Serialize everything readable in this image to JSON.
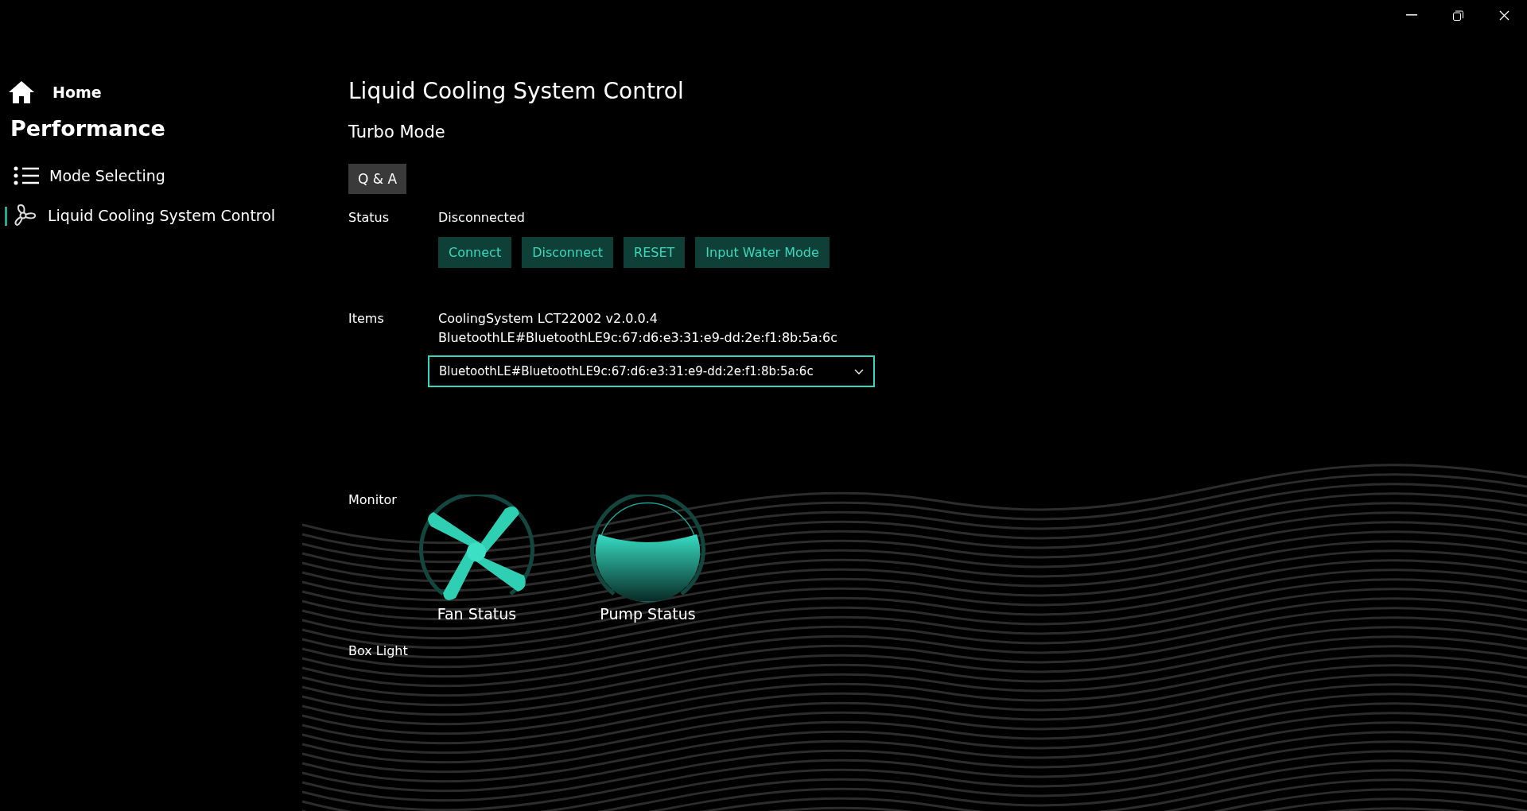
{
  "sidebar": {
    "home": "Home",
    "section": "Performance",
    "items": [
      {
        "label": "Mode Selecting",
        "kind": "list",
        "selected": false
      },
      {
        "label": "Liquid Cooling System Control",
        "kind": "fan",
        "selected": true
      }
    ]
  },
  "page": {
    "title": "Liquid Cooling System Control",
    "subtitle": "Turbo Mode",
    "qa_button": "Q & A",
    "status": {
      "label": "Status",
      "value": "Disconnected",
      "buttons": [
        "Connect",
        "Disconnect",
        "RESET",
        "Input Water Mode"
      ]
    },
    "items": {
      "label": "Items",
      "lines": [
        "CoolingSystem LCT22002 v2.0.0.4",
        "BluetoothLE#BluetoothLE9c:67:d6:e3:31:e9-dd:2e:f1:8b:5a:6c"
      ],
      "dropdown": {
        "value": "BluetoothLE#BluetoothLE9c:67:d6:e3:31:e9-dd:2e:f1:8b:5a:6c"
      }
    },
    "monitor": {
      "label": "Monitor",
      "gauges": [
        {
          "kind": "fan",
          "label": "Fan Status"
        },
        {
          "kind": "pump",
          "label": "Pump Status"
        }
      ]
    },
    "box_light": {
      "label": "Box Light"
    }
  }
}
